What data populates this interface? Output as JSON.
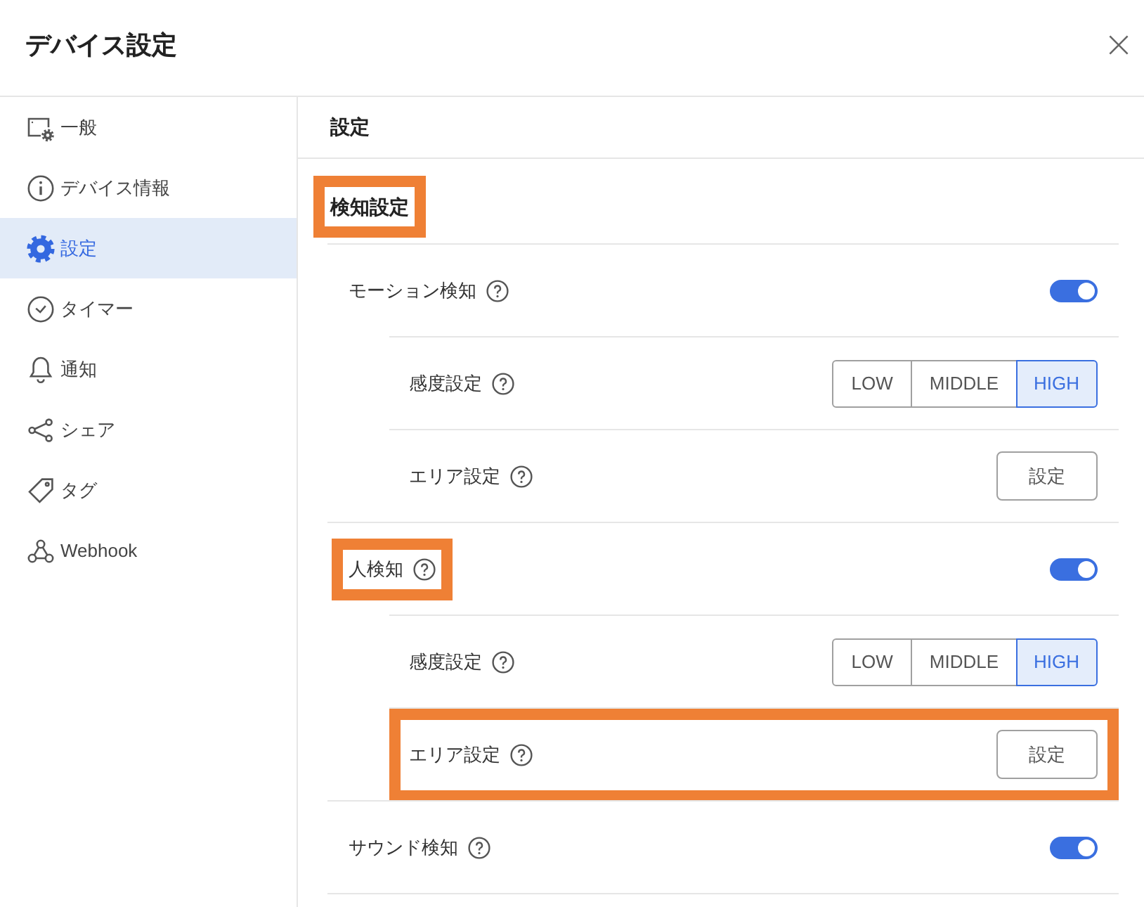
{
  "window": {
    "title": "デバイス設定"
  },
  "sidebar": {
    "items": [
      {
        "label": "一般",
        "selected": false
      },
      {
        "label": "デバイス情報",
        "selected": false
      },
      {
        "label": "設定",
        "selected": true
      },
      {
        "label": "タイマー",
        "selected": false
      },
      {
        "label": "通知",
        "selected": false
      },
      {
        "label": "シェア",
        "selected": false
      },
      {
        "label": "タグ",
        "selected": false
      },
      {
        "label": "Webhook",
        "selected": false
      }
    ]
  },
  "panel": {
    "title": "設定",
    "section": {
      "title": "検知設定",
      "highlighted": true,
      "rows": [
        {
          "kind": "toggle",
          "label": "モーション検知",
          "on": true,
          "label_highlighted": false,
          "row_highlighted": false,
          "children": [
            {
              "kind": "segmented",
              "label": "感度設定",
              "label_highlighted": false,
              "row_highlighted": false,
              "options": [
                {
                  "label": "LOW",
                  "selected": false
                },
                {
                  "label": "MIDDLE",
                  "selected": false
                },
                {
                  "label": "HIGH",
                  "selected": true
                }
              ]
            },
            {
              "kind": "button",
              "label": "エリア設定",
              "label_highlighted": false,
              "row_highlighted": false,
              "button": "設定"
            }
          ]
        },
        {
          "kind": "toggle",
          "label": "人検知",
          "on": true,
          "label_highlighted": true,
          "row_highlighted": false,
          "children": [
            {
              "kind": "segmented",
              "label": "感度設定",
              "label_highlighted": false,
              "row_highlighted": false,
              "options": [
                {
                  "label": "LOW",
                  "selected": false
                },
                {
                  "label": "MIDDLE",
                  "selected": false
                },
                {
                  "label": "HIGH",
                  "selected": true
                }
              ]
            },
            {
              "kind": "button",
              "label": "エリア設定",
              "label_highlighted": false,
              "row_highlighted": true,
              "button": "設定"
            }
          ]
        },
        {
          "kind": "toggle",
          "label": "サウンド検知",
          "on": true,
          "label_highlighted": false,
          "row_highlighted": false
        }
      ]
    }
  }
}
